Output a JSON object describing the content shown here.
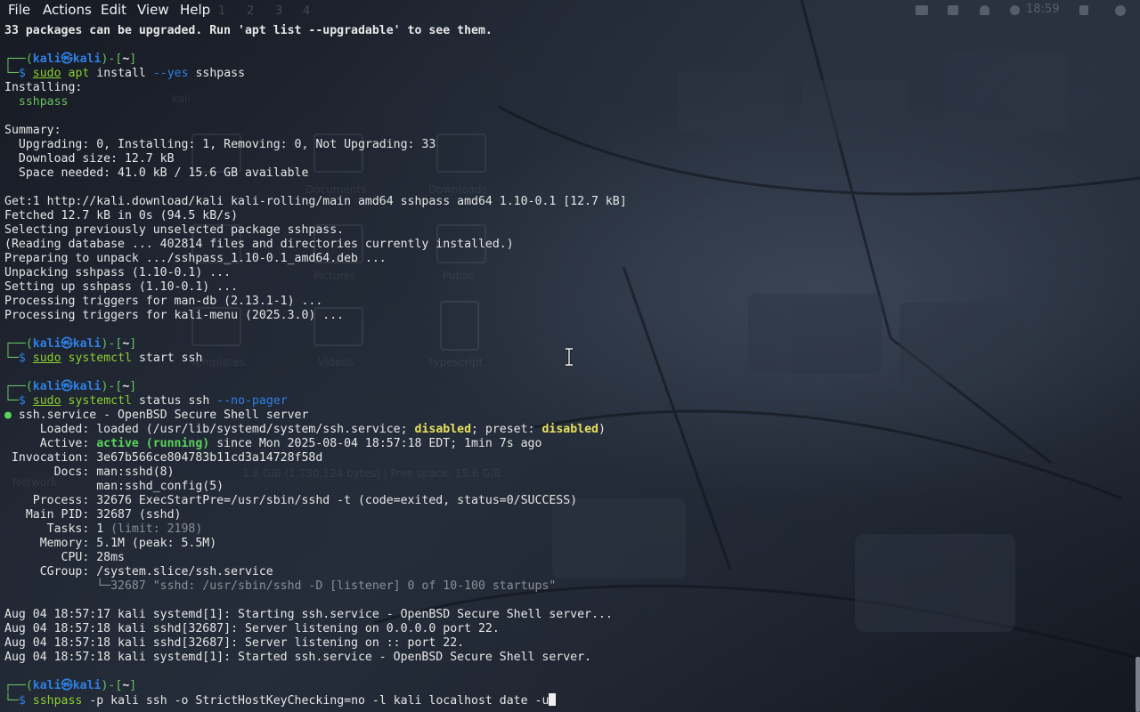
{
  "menubar": {
    "items": [
      "File",
      "Actions",
      "Edit",
      "View",
      "Help"
    ],
    "workspaces": [
      "1",
      "2",
      "3",
      "4"
    ],
    "clock": "18:59"
  },
  "desktop": {
    "labels": [
      "kali",
      "Documents",
      "Downloads",
      "Pictures",
      "Public",
      "Templates",
      "Videos",
      "typescript",
      "Network",
      "1.6 GiB (1,730,124 bytes) | Free space: 15.6 GiB"
    ]
  },
  "terminal": {
    "line_upgrade": "33 packages can be upgraded. Run 'apt list --upgradable' to see them.",
    "prompt_user": "kali",
    "prompt_at": "㉿",
    "prompt_host": "kali",
    "prompt_dir": "~",
    "cmd1_sudo": "sudo",
    "cmd1_apt": "apt",
    "cmd1_rest": "install",
    "cmd1_flag": "--yes",
    "cmd1_pkg": "sshpass",
    "out1": [
      "Installing:",
      "  sshpass",
      "",
      "Summary:",
      "  Upgrading: 0, Installing: 1, Removing: 0, Not Upgrading: 33",
      "  Download size: 12.7 kB",
      "  Space needed: 41.0 kB / 15.6 GB available",
      "",
      "Get:1 http://kali.download/kali kali-rolling/main amd64 sshpass amd64 1.10-0.1 [12.7 kB]",
      "Fetched 12.7 kB in 0s (94.5 kB/s)",
      "Selecting previously unselected package sshpass.",
      "(Reading database ... 402814 files and directories currently installed.)",
      "Preparing to unpack .../sshpass_1.10-0.1_amd64.deb ...",
      "Unpacking sshpass (1.10-0.1) ...",
      "Setting up sshpass (1.10-0.1) ...",
      "Processing triggers for man-db (2.13.1-1) ...",
      "Processing triggers for kali-menu (2025.3.0) ..."
    ],
    "cmd2_sudo": "sudo",
    "cmd2_prog": "systemctl",
    "cmd2_rest": "start ssh",
    "cmd3_sudo": "sudo",
    "cmd3_prog": "systemctl",
    "cmd3_rest": "status ssh",
    "cmd3_flag": "--no-pager",
    "status": {
      "dot": "●",
      "title": "ssh.service - OpenBSD Secure Shell server",
      "loaded_pre": "     Loaded: loaded (/usr/lib/systemd/system/ssh.service; ",
      "loaded_disabled": "disabled",
      "loaded_mid": "; preset: ",
      "loaded_preset": "disabled",
      "loaded_post": ")",
      "active_pre": "     Active: ",
      "active_state": "active (running)",
      "active_post": " since Mon 2025-08-04 18:57:18 EDT; 1min 7s ago",
      "invocation": " Invocation: 3e67b566ce804783b11cd3a14728f58d",
      "docs1": "       Docs: man:sshd(8)",
      "docs2": "             man:sshd_config(5)",
      "process": "    Process: 32676 ExecStartPre=/usr/sbin/sshd -t (code=exited, status=0/SUCCESS)",
      "mainpid": "   Main PID: 32687 (sshd)",
      "tasks_pre": "      Tasks: 1 ",
      "tasks_limit": "(limit: 2198)",
      "memory": "     Memory: 5.1M (peak: 5.5M)",
      "cpu": "        CPU: 28ms",
      "cgroup": "     CGroup: /system.slice/ssh.service",
      "cgroup_child": "             └─32687 \"sshd: /usr/sbin/sshd -D [listener] 0 of 10-100 startups\""
    },
    "journal": [
      "Aug 04 18:57:17 kali systemd[1]: Starting ssh.service - OpenBSD Secure Shell server...",
      "Aug 04 18:57:18 kali sshd[32687]: Server listening on 0.0.0.0 port 22.",
      "Aug 04 18:57:18 kali sshd[32687]: Server listening on :: port 22.",
      "Aug 04 18:57:18 kali systemd[1]: Started ssh.service - OpenBSD Secure Shell server."
    ],
    "cmd4_prog": "sshpass",
    "cmd4_rest": " -p kali ssh -o StrictHostKeyChecking=no -l kali localhost date -u"
  }
}
